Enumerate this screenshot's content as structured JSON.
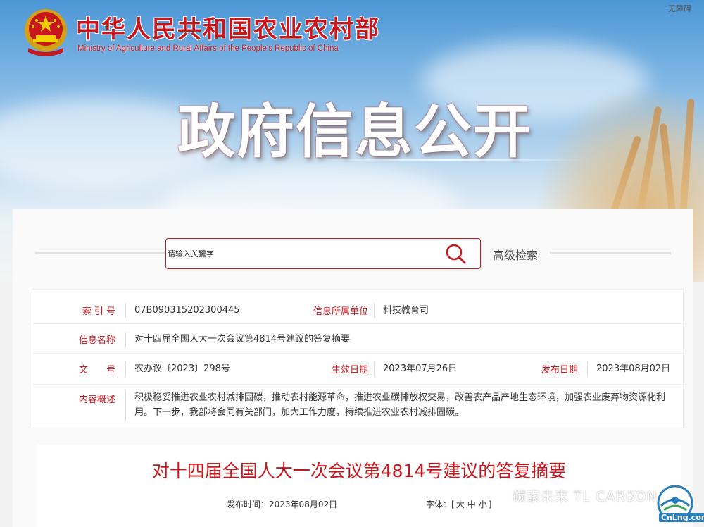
{
  "header": {
    "ministry_cn": "中华人民共和国农业农村部",
    "ministry_en": "Ministry of Agriculture and Rural Affairs of the People's Republic of China",
    "accessibility_link": "无障碍",
    "section_title": "政府信息公开"
  },
  "search": {
    "placeholder": "请输入关键字",
    "advanced_label": "高级检索"
  },
  "info": {
    "index_label": "索 引 号",
    "index_value": "07B090315202300445",
    "unit_label": "信息所属单位",
    "unit_value": "科技教育司",
    "name_label": "信息名称",
    "name_value": "对十四届全国人大一次会议第4814号建议的答复摘要",
    "doc_label": "文　　号",
    "doc_value": "农办议〔2023〕298号",
    "effective_label": "生效日期",
    "effective_value": "2023年07月26日",
    "publish_label": "发布日期",
    "publish_value": "2023年08月02日",
    "summary_label": "内容概述",
    "summary_value": "积极稳妥推进农业农村减排固碳，推动农村能源革命，推进农业碳排放权交易，改善农产品产地生态环境，加强农业废弃物资源化利用。下一步，我部将会同有关部门，加大工作力度，持续推进农业农村减排固碳。"
  },
  "article": {
    "title": "对十四届全国人大一次会议第4814号建议的答复摘要",
    "publish_time_label": "发布时间：",
    "publish_time_value": "2023年08月02日",
    "font_label": "字体：",
    "font_large": "大",
    "font_medium": "中",
    "font_small": "小"
  },
  "watermark": {
    "text": "碳索未来 TL CARBON",
    "logo_text": "CnLng.com"
  },
  "colors": {
    "brand_red": "#c8161d",
    "sky_blue": "#4c97d6"
  }
}
